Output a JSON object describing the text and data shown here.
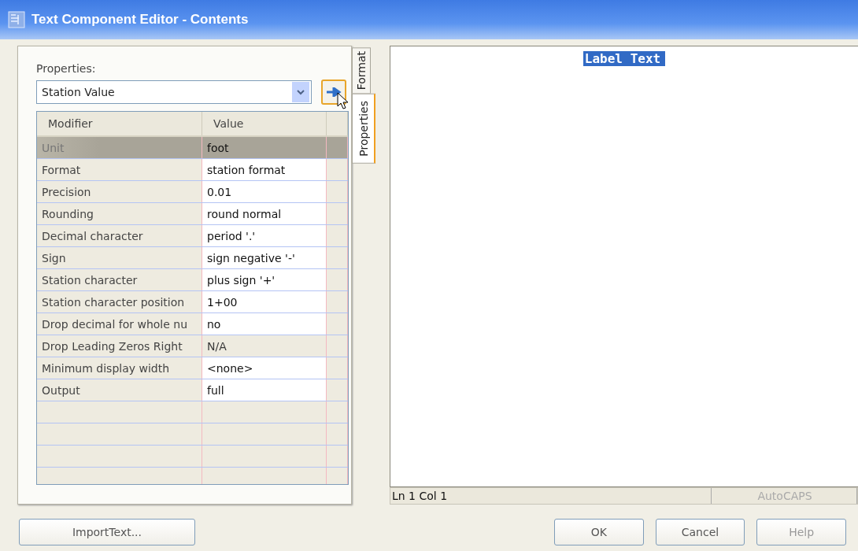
{
  "window": {
    "title": "Text Component Editor - Contents"
  },
  "properties": {
    "label": "Properties:",
    "value": "Station Value"
  },
  "table": {
    "columns": [
      "Modifier",
      "Value"
    ],
    "rows": [
      {
        "modifier": "Unit",
        "value": "foot",
        "selected": true,
        "disabled": false
      },
      {
        "modifier": "Format",
        "value": "station format",
        "selected": false,
        "disabled": false
      },
      {
        "modifier": "Precision",
        "value": "0.01",
        "selected": false,
        "disabled": false
      },
      {
        "modifier": "Rounding",
        "value": "round normal",
        "selected": false,
        "disabled": false
      },
      {
        "modifier": "Decimal character",
        "value": "period '.'",
        "selected": false,
        "disabled": false
      },
      {
        "modifier": "Sign",
        "value": "sign negative '-'",
        "selected": false,
        "disabled": false
      },
      {
        "modifier": "Station character",
        "value": "plus sign '+'",
        "selected": false,
        "disabled": false
      },
      {
        "modifier": "Station character position",
        "value": "1+00",
        "selected": false,
        "disabled": false
      },
      {
        "modifier": "Drop decimal for whole nu",
        "value": "no",
        "selected": false,
        "disabled": false
      },
      {
        "modifier": "Drop Leading Zeros Right",
        "value": "N/A",
        "selected": false,
        "disabled": true
      },
      {
        "modifier": "Minimum display width",
        "value": "<none>",
        "selected": false,
        "disabled": false
      },
      {
        "modifier": "Output",
        "value": "full",
        "selected": false,
        "disabled": false
      }
    ]
  },
  "tabs": [
    {
      "label": "Format",
      "selected": false
    },
    {
      "label": "Properties",
      "selected": true
    }
  ],
  "editor": {
    "text": "Label Text"
  },
  "status_bar": [
    {
      "text": "Ln 1 Col 1",
      "disabled": false
    },
    {
      "text": "AutoCAPS",
      "disabled": true
    }
  ],
  "buttons": [
    {
      "label": "ImportText...",
      "disabled": false
    },
    {
      "label": "OK",
      "disabled": false
    },
    {
      "label": "Cancel",
      "disabled": false
    },
    {
      "label": "Help",
      "disabled": true
    }
  ]
}
